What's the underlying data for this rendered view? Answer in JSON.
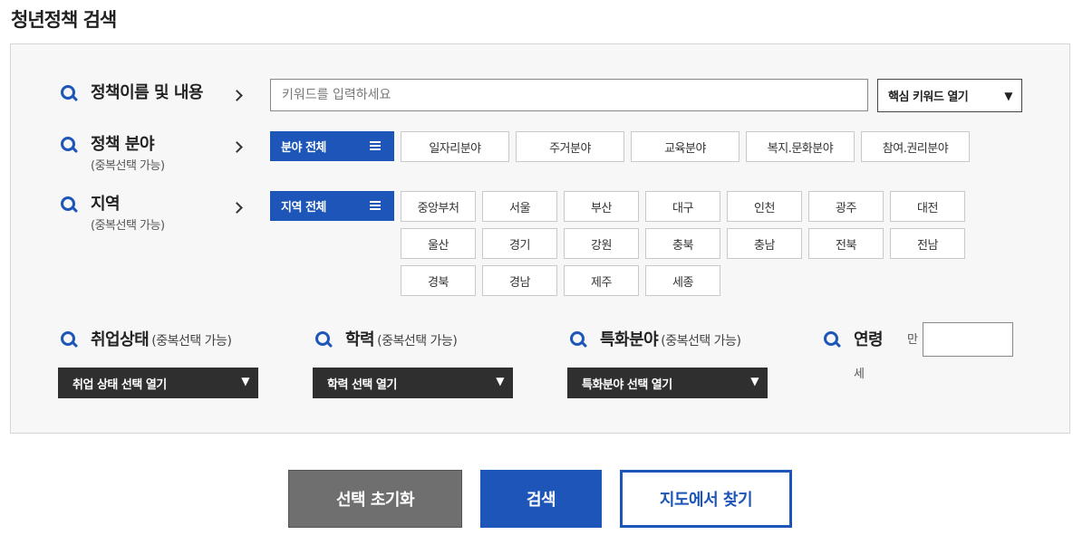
{
  "page_title": "청년정책 검색",
  "colors": {
    "accent": "#1d56b8",
    "dark": "#2f2f2f",
    "panel_bg": "#f7f7f7",
    "reset_bg": "#6f6f6f"
  },
  "keyword": {
    "label": "정책이름 및 내용",
    "placeholder": "키워드를 입력하세요",
    "toggle_label": "핵심 키워드 열기"
  },
  "field": {
    "label": "정책 분야",
    "sub": "(중복선택 가능)",
    "all_label": "분야 전체",
    "options": [
      "일자리분야",
      "주거분야",
      "교육분야",
      "복지.문화분야",
      "참여.권리분야"
    ]
  },
  "region": {
    "label": "지역",
    "sub": "(중복선택 가능)",
    "all_label": "지역 전체",
    "options": [
      "중앙부처",
      "서울",
      "부산",
      "대구",
      "인천",
      "광주",
      "대전",
      "울산",
      "경기",
      "강원",
      "충북",
      "충남",
      "전북",
      "전남",
      "경북",
      "경남",
      "제주",
      "세종"
    ]
  },
  "employment": {
    "label": "취업상태",
    "sub": "(중복선택 가능)",
    "select_label": "취업 상태 선택 열기"
  },
  "education": {
    "label": "학력",
    "sub": "(중복선택 가능)",
    "select_label": "학력 선택 열기"
  },
  "specialty": {
    "label": "특화분야",
    "sub": "(중복선택 가능)",
    "select_label": "특화분야 선택 열기"
  },
  "age": {
    "label": "연령",
    "prefix": "만",
    "unit": "세",
    "value": ""
  },
  "icons": {
    "search": "search-icon",
    "chevron": "chevron-right-icon",
    "menu": "menu-icon",
    "caret": "caret-down-icon"
  },
  "buttons": {
    "reset": "선택 초기화",
    "search": "검색",
    "map": "지도에서 찾기"
  }
}
